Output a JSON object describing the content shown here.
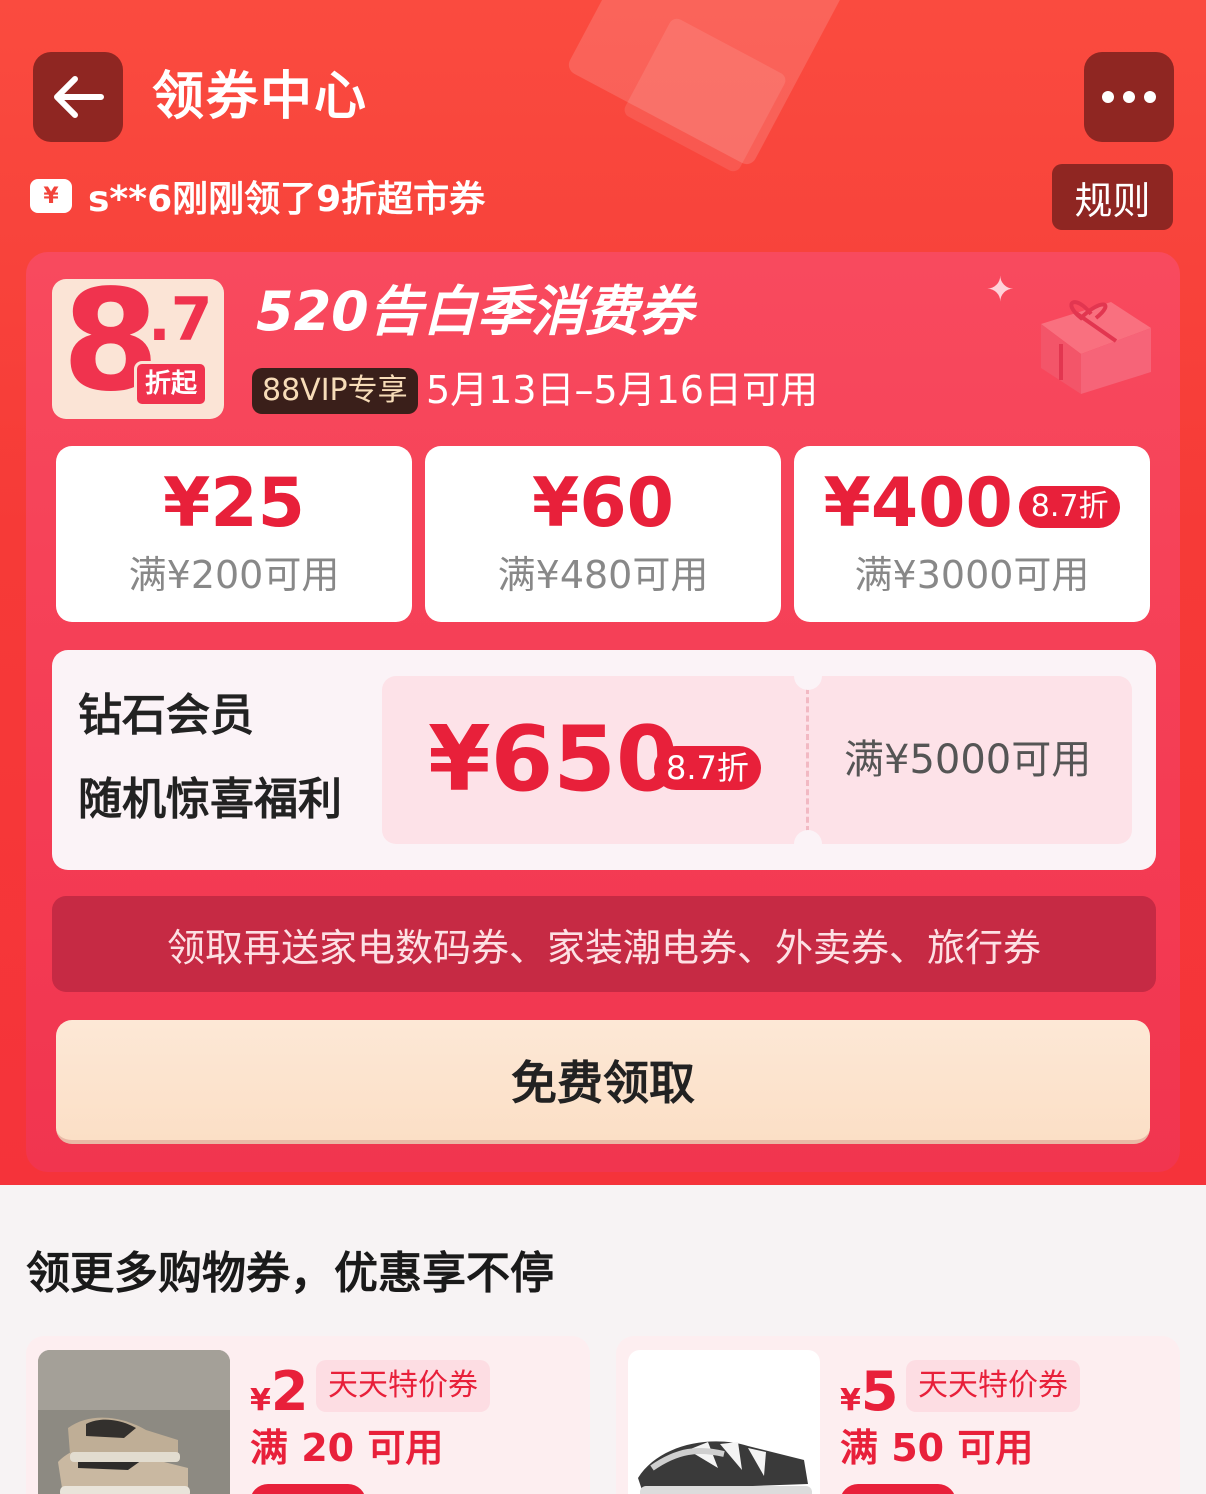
{
  "header": {
    "title": "领券中心",
    "ticker": "s**6刚刚领了9折超市券",
    "ticker_icon": "¥",
    "rules_label": "规则"
  },
  "campaign": {
    "badge_big": "8",
    "badge_small": ".7",
    "badge_sub": "折起",
    "title": "520告白季消费券",
    "vip_tag": "88VIP专享",
    "valid": "5月13日–5月16日可用",
    "tiers": [
      {
        "amount": "¥25",
        "discount": "",
        "condition": "满¥200可用"
      },
      {
        "amount": "¥60",
        "discount": "",
        "condition": "满¥480可用"
      },
      {
        "amount": "¥400",
        "discount": "8.7折",
        "condition": "满¥3000可用"
      }
    ],
    "diamond": {
      "line1": "钻石会员",
      "line2": "随机惊喜福利",
      "amount": "¥650",
      "discount": "8.7折",
      "condition": "满¥5000可用"
    },
    "bonus_text": "领取再送家电数码券、家装潮电券、外卖券、旅行券",
    "claim_label": "免费领取"
  },
  "more_section": {
    "title": "领更多购物券，优惠享不停",
    "coupons": [
      {
        "yen": "¥",
        "amount": "2",
        "tag": "天天特价券",
        "condition": "满 20 可用"
      },
      {
        "yen": "¥",
        "amount": "5",
        "tag": "天天特价券",
        "condition": "满 50 可用"
      }
    ]
  },
  "colors": {
    "accent_red": "#e8203a",
    "hero_red": "#f63a37",
    "dark_button": "#8f2622",
    "claim_button": "#fbdfc6"
  }
}
